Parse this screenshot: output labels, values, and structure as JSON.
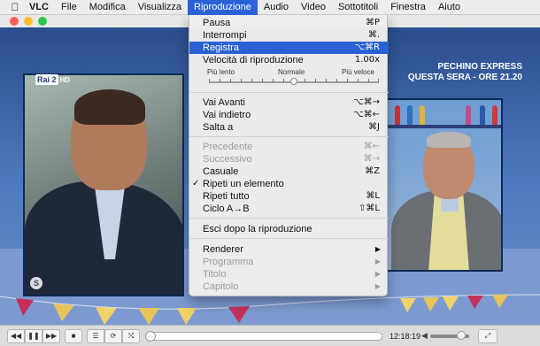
{
  "menubar": {
    "apple_icon": "apple-logo-icon",
    "items": [
      {
        "label": "VLC"
      },
      {
        "label": "File"
      },
      {
        "label": "Modifica"
      },
      {
        "label": "Visualizza"
      },
      {
        "label": "Riproduzione"
      },
      {
        "label": "Audio"
      },
      {
        "label": "Video"
      },
      {
        "label": "Sottotitoli"
      },
      {
        "label": "Finestra"
      },
      {
        "label": "Aiuto"
      }
    ]
  },
  "video": {
    "channel_logo": "Rai 2",
    "channel_hd": "HD",
    "overlay_line1": "PECHINO EXPRESS",
    "overlay_line2": "QUESTA SERA - ORE 21.20",
    "skype_badge": "S"
  },
  "menu": {
    "pausa": {
      "label": "Pausa",
      "shortcut": "⌘P"
    },
    "interrompi": {
      "label": "Interrompi",
      "shortcut": "⌘."
    },
    "registra": {
      "label": "Registra",
      "shortcut": "⌥⌘R"
    },
    "velocita": {
      "label": "Velocità di riproduzione",
      "value": "1.00x"
    },
    "speed_slow": "Più lento",
    "speed_normal": "Normale",
    "speed_fast": "Più veloce",
    "speed_value": 1.0,
    "vai_avanti": {
      "label": "Vai Avanti",
      "shortcut": "⌥⌘→"
    },
    "vai_indietro": {
      "label": "Vai indietro",
      "shortcut": "⌥⌘←"
    },
    "salta_a": {
      "label": "Salta a",
      "shortcut": "⌘J"
    },
    "precedente": {
      "label": "Precedente",
      "shortcut": "⌘←"
    },
    "successivo": {
      "label": "Successivo",
      "shortcut": "⌘→"
    },
    "casuale": {
      "label": "Casuale",
      "shortcut": "⌘Z"
    },
    "ripeti_uno": {
      "label": "Ripeti un elemento",
      "check": "✓"
    },
    "ripeti_tutto": {
      "label": "Ripeti tutto",
      "shortcut": "⌘L"
    },
    "ciclo": {
      "label": "Ciclo A→B",
      "shortcut": "⇧⌘L"
    },
    "esci": {
      "label": "Esci dopo la riproduzione"
    },
    "renderer": {
      "label": "Renderer"
    },
    "programma": {
      "label": "Programma"
    },
    "titolo": {
      "label": "Titolo"
    },
    "capitolo": {
      "label": "Capitolo"
    },
    "submenu_arrow": "▶"
  },
  "controls": {
    "rewind": "◀◀",
    "play_pause": "❚❚",
    "forward": "▶▶",
    "stop": "■",
    "playlist": "☰",
    "loop": "⟳",
    "shuffle": "⤭",
    "time": "12:18:19",
    "volume_icon": "◀",
    "volume_level": 0.8,
    "progress": 0.0,
    "fullscreen": "⤢"
  },
  "colors": {
    "menu_highlight": "#2a62d6",
    "menubar_bg": "#ececec",
    "video_blue": "#2a4d8c"
  }
}
